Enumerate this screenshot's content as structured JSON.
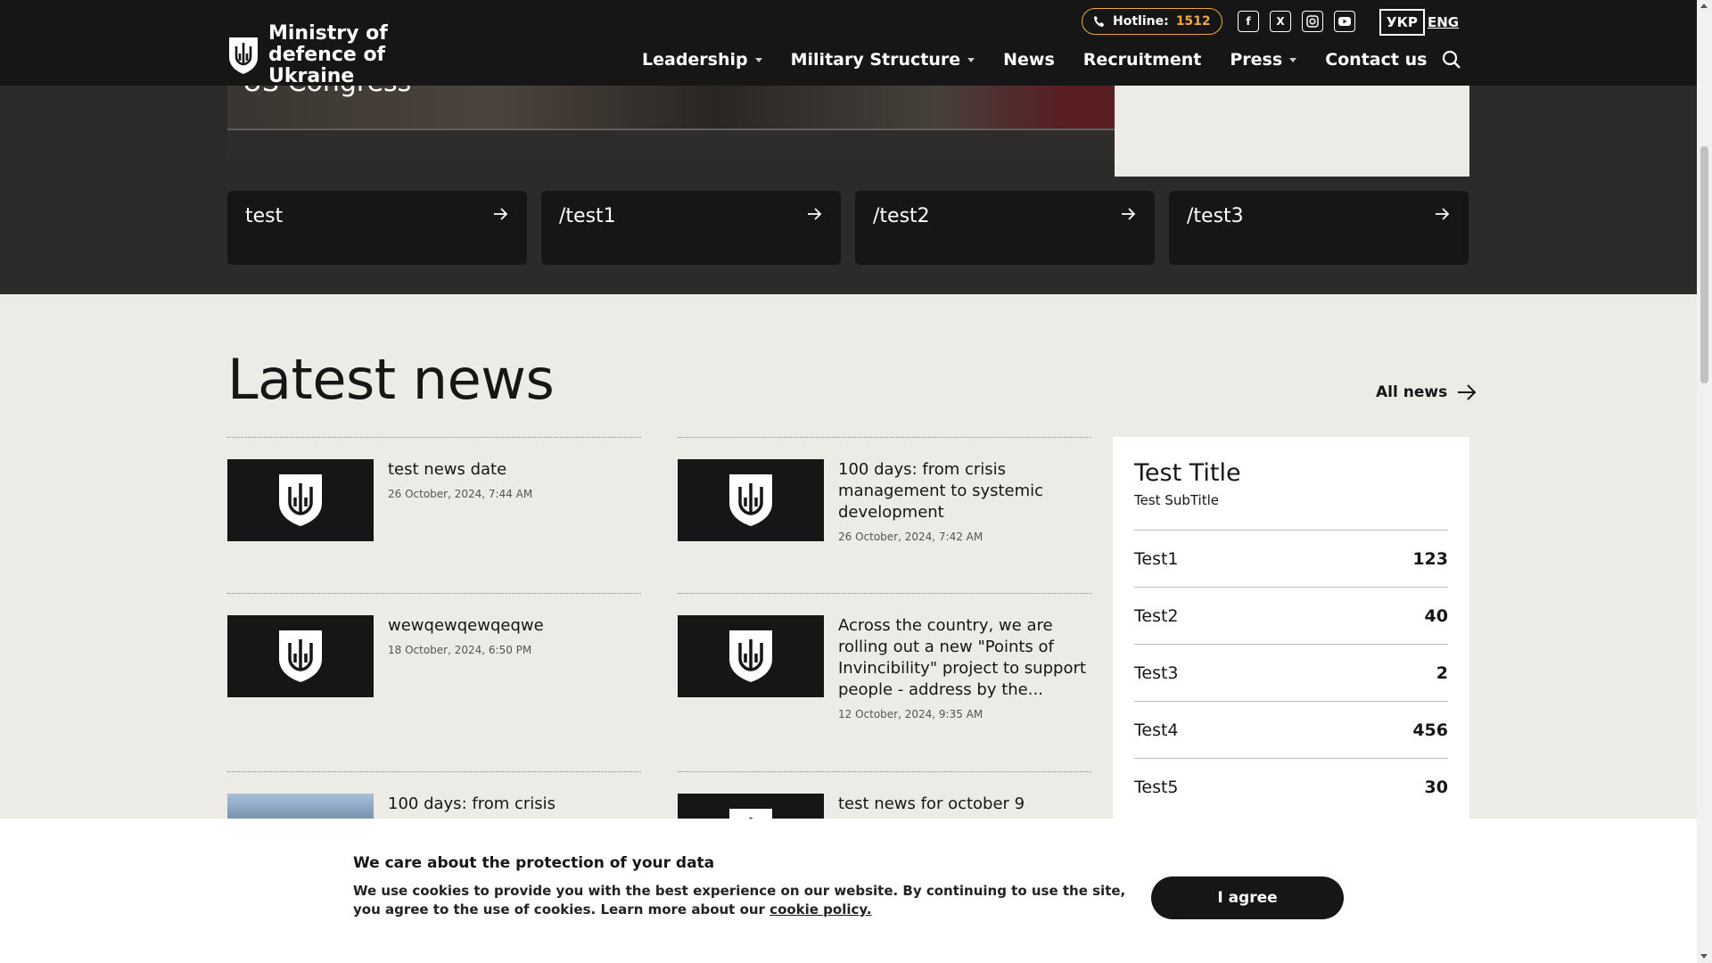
{
  "header": {
    "logo_text": "Ministry of defence of Ukraine",
    "hotline_label": "Hotline:",
    "hotline_number": "1512",
    "social_icons": [
      "facebook-icon",
      "x-icon",
      "instagram-icon",
      "youtube-icon"
    ],
    "lang_active": "УКР",
    "lang_other": "ENG",
    "nav": [
      {
        "label": "Leadership",
        "has_dropdown": true
      },
      {
        "label": "Military Structure",
        "has_dropdown": true
      },
      {
        "label": "News",
        "has_dropdown": false
      },
      {
        "label": "Recruitment",
        "has_dropdown": false
      },
      {
        "label": "Press",
        "has_dropdown": true
      },
      {
        "label": "Contact us",
        "has_dropdown": false
      }
    ]
  },
  "hero": {
    "caption": "US Congress"
  },
  "quick_links": [
    "test",
    "/test1",
    "/test2",
    "/test3"
  ],
  "latest_news": {
    "title": "Latest news",
    "all_news_label": "All news",
    "left_column": [
      {
        "headline": "test news date",
        "date": "26 October, 2024, 7:44 AM",
        "thumb": "logo"
      },
      {
        "headline": "wewqewqewqeqwe",
        "date": "18 October, 2024, 6:50 PM",
        "thumb": "logo"
      },
      {
        "headline": "100 days: from crisis",
        "date": "",
        "thumb": "photo"
      }
    ],
    "right_column": [
      {
        "headline": "100 days: from crisis management to systemic development",
        "date": "26 October, 2024, 7:42 AM",
        "thumb": "logo"
      },
      {
        "headline": "Across the country, we are rolling out a new \"Points of Invincibility\" project to support people - address by the...",
        "date": "12 October, 2024, 9:35 AM",
        "thumb": "logo"
      },
      {
        "headline": "test news for october 9",
        "date": "",
        "thumb": "logo"
      }
    ]
  },
  "stats_widget": {
    "title": "Test Title",
    "subtitle": "Test SubTitle",
    "rows": [
      {
        "label": "Test1",
        "value": "123"
      },
      {
        "label": "Test2",
        "value": "40"
      },
      {
        "label": "Test3",
        "value": "2"
      },
      {
        "label": "Test4",
        "value": "456"
      },
      {
        "label": "Test5",
        "value": "30"
      }
    ]
  },
  "cookie_banner": {
    "title": "We care about the protection of your data",
    "text": "We use cookies to provide you with the best experience on our website. By continuing to use the site, you agree to the use of cookies. Learn more about our ",
    "link_text": "cookie policy.",
    "button_label": "I agree"
  },
  "colors": {
    "header_bg": "#161616",
    "hero_bg": "#2c2b29",
    "page_bg": "#edebe6",
    "hotline_accent": "#f3a73b"
  }
}
